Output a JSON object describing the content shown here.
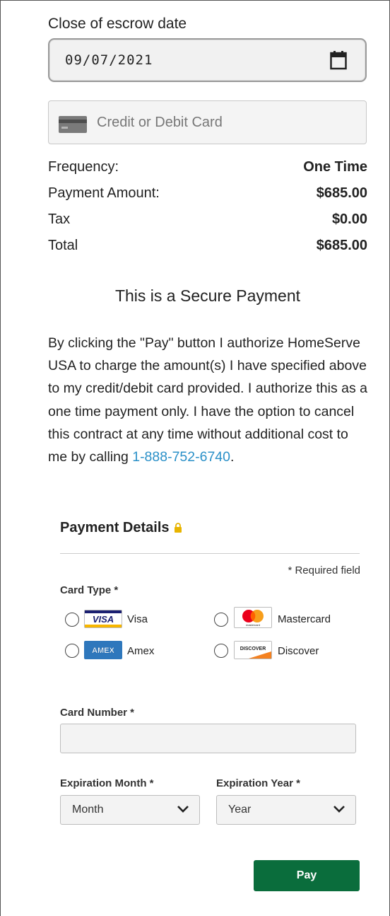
{
  "escrow": {
    "label": "Close of escrow date",
    "date_value": "09/07/2021"
  },
  "card_field": {
    "placeholder": "Credit or Debit Card"
  },
  "summary": [
    {
      "key": "Frequency:",
      "value": "One Time"
    },
    {
      "key": "Payment Amount:",
      "value": "$685.00"
    },
    {
      "key": "Tax",
      "value": "$0.00"
    },
    {
      "key": "Total",
      "value": "$685.00"
    }
  ],
  "secure_title": "This is a Secure Payment",
  "authorization": {
    "text": "By clicking the \"Pay\" button I authorize HomeServe USA to charge the amount(s) I have specified above to my credit/debit card provided. I authorize this as a one time payment only. I have the option to cancel this contract at any time without additional cost to me by calling ",
    "phone": "1-888-752-6740",
    "end": "."
  },
  "payment_details": {
    "title": "Payment Details",
    "required_note": "* Required field",
    "card_type_label": "Card Type *",
    "card_types": [
      {
        "name": "Visa",
        "logo_text": "VISA"
      },
      {
        "name": "Mastercard",
        "logo_text": "mastercard"
      },
      {
        "name": "Amex",
        "logo_text": "AMEX"
      },
      {
        "name": "Discover",
        "logo_text": "DISCOVER"
      }
    ],
    "card_number_label": "Card Number *",
    "exp_month_label": "Expiration Month *",
    "exp_month_value": "Month",
    "exp_year_label": "Expiration Year *",
    "exp_year_value": "Year",
    "pay_button": "Pay"
  },
  "colors": {
    "accent_green": "#0a6d3c",
    "link_blue": "#2a90c8",
    "lock_gold": "#e8b400"
  },
  "icons": [
    "calendar-icon",
    "credit-card-icon",
    "lock-icon",
    "chevron-down-icon"
  ]
}
